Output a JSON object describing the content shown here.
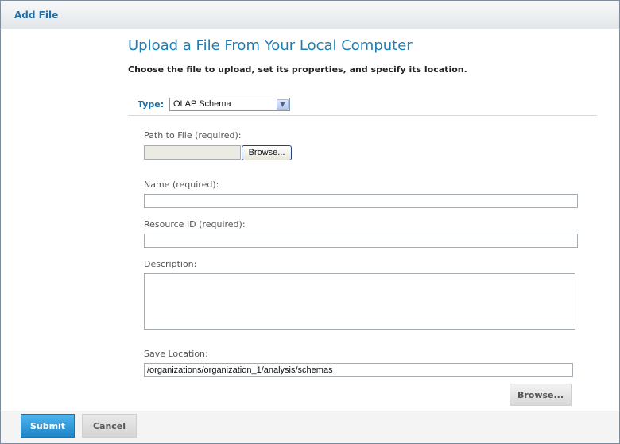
{
  "dialog": {
    "title": "Add File"
  },
  "content": {
    "heading": "Upload a File From Your Local Computer",
    "subheading": "Choose the file to upload, set its properties, and specify its location."
  },
  "type_field": {
    "label": "Type:",
    "selected": "OLAP Schema"
  },
  "path_field": {
    "label": "Path to File (required):",
    "value": "",
    "browse_label": "Browse..."
  },
  "name_field": {
    "label": "Name (required):",
    "value": ""
  },
  "resource_id_field": {
    "label": "Resource ID (required):",
    "value": ""
  },
  "description_field": {
    "label": "Description:",
    "value": ""
  },
  "save_location_field": {
    "label": "Save Location:",
    "value": "/organizations/organization_1/analysis/schemas",
    "browse_label": "Browse..."
  },
  "footer": {
    "submit_label": "Submit",
    "cancel_label": "Cancel"
  }
}
